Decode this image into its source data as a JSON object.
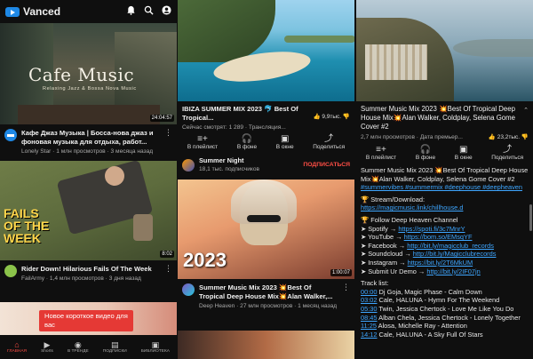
{
  "app": {
    "name": "Vanced"
  },
  "icons": {
    "bell": "bell-icon",
    "search": "search-icon",
    "account": "account-icon"
  },
  "feed": [
    {
      "thumb_title": "Cafe Music",
      "thumb_subtitle": "Relaxing Jazz & Bossa Nova Music",
      "duration": "24:04:57",
      "title": "Кафе Джаз Музыка | Босса-нова джаз и фоновая музыка для отдыха, работ...",
      "meta": "Lonely Star · 1 млн просмотров · 3 месяца назад"
    },
    {
      "thumb_title": "FAILS OF THE WEEK",
      "duration": "8:02",
      "title": "Rider Down! Hilarious Fails Of The Week",
      "meta": "FailArmy · 1,4 млн просмотров · 3 дня назад"
    }
  ],
  "toast": "Новое короткое видео для вас",
  "bottom_nav": [
    {
      "label": "ГЛАВНАЯ",
      "icon": "home-icon",
      "active": true
    },
    {
      "label": "Shorts",
      "icon": "shorts-icon",
      "active": false
    },
    {
      "label": "В ТРЕНДЕ",
      "icon": "trending-icon",
      "active": false
    },
    {
      "label": "ПОДПИСКИ",
      "icon": "subscriptions-icon",
      "active": false
    },
    {
      "label": "БИБЛИОТЕКА",
      "icon": "library-icon",
      "active": false
    }
  ],
  "player1": {
    "title": "IBIZA SUMMER MIX 2023 🐬 Best Of Tropical...",
    "meta": "Сейчас смотрят: 1 289 · Трансляция...",
    "likes": "9,9тыс.",
    "actions": [
      "В плейлист",
      "В фоне",
      "В окне",
      "Поделиться"
    ],
    "channel": "Summer Night",
    "channel_subs": "18,1 тыс. подписчиков",
    "subscribe": "ПОДПИСАТЬСЯ"
  },
  "next_video": {
    "thumb_title": "2023",
    "duration": "1:00:07",
    "title": "Summer Music Mix 2023 💥Best Of Tropical Deep House Mix💥Alan Walker,...",
    "meta": "Deep Heaven · 27 млн просмотров · 1 месяц назад"
  },
  "player2": {
    "title": "Summer Music Mix 2023 💥Best Of Tropical Deep House Mix💥Alan Walker, Coldplay, Selena Gome Cover #2",
    "meta": "2,7 млн просмотров · Дата премьер...",
    "likes": "23,2тыс.",
    "actions": [
      "В плейлист",
      "В фоне",
      "В окне",
      "Поделиться"
    ],
    "desc_title": "Summer Music Mix 2023 💥Best Of Tropical Deep House Mix💥Alan Walker, Coldplay, Selena Gome Cover #2",
    "hashtags": "#summervibes #summermix #deephouse #deepheaven",
    "stream_label": "🏆 Stream/Download:",
    "stream_link": "https://magicmusic.link/chillhouse.d",
    "follow": "🏆 Follow Deep Heaven Channel",
    "social": [
      {
        "label": "➤ Spotify → ",
        "link": "https://spoti.fi/3c7MnrY"
      },
      {
        "label": "➤ YouTube → ",
        "link": "https://bom.so/EMsqYF"
      },
      {
        "label": "➤ Facebook → ",
        "link": "http://bit.ly/magicclub_records"
      },
      {
        "label": "➤ Soundcloud → ",
        "link": "http://bit.ly/Magicclubrecords"
      },
      {
        "label": "➤ Instagram → ",
        "link": "https://bit.ly/2T6MkUM"
      },
      {
        "label": "➤ Submit Ur Demo → ",
        "link": "http://bit.ly/2IF07jn"
      }
    ],
    "tracklist_label": "Track list:",
    "tracks": [
      {
        "time": "00:00",
        "name": " Dj Goja, Magic Phase - Calm Down"
      },
      {
        "time": "03:02",
        "name": " Cale, HALUNA - Hymn For The Weekend"
      },
      {
        "time": "05:30",
        "name": " Twin, Jessica Chertock - Love Me Like You Do"
      },
      {
        "time": "08:45",
        "name": " Alban Chela, Jessica Chertock - Lonely Together"
      },
      {
        "time": "11:25",
        "name": " Alosa, Michelle Ray - Attention"
      },
      {
        "time": "14:12",
        "name": " Cale, HALUNA - A Sky Full Of Stars"
      }
    ]
  }
}
